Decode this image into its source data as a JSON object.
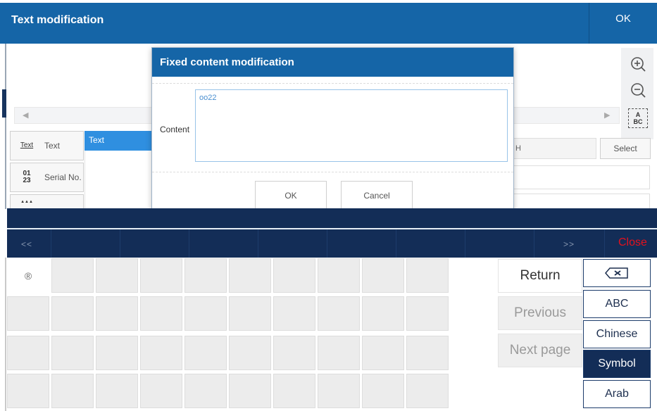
{
  "header": {
    "title": "Text modification",
    "ok_label": "OK"
  },
  "toolbar": {
    "icons": [
      "zoom-in-icon",
      "zoom-out-icon",
      "text-frame-icon"
    ],
    "text_frame_glyph": "A\nBC"
  },
  "objects": [
    {
      "icon_text": "Text",
      "label": "Text"
    },
    {
      "icon_text": "01\n23",
      "label": "Serial No."
    },
    {
      "icon_text": "▲▲▲",
      "label": ""
    }
  ],
  "list": {
    "selected_item": "Text"
  },
  "field": {
    "header_text": "H",
    "select_label": "Select"
  },
  "dialog": {
    "title": "Fixed content modification",
    "content_label": "Content",
    "content_value": "oo22",
    "ok_label": "OK",
    "cancel_label": "Cancel"
  },
  "keyboard": {
    "prev_label": "<<",
    "next_label": ">>",
    "close_label": "Close",
    "first_key": "®",
    "actions": {
      "return": "Return",
      "previous": "Previous",
      "next_page": "Next page"
    },
    "modes": [
      "ABC",
      "Chinese",
      "Symbol",
      "Arab"
    ],
    "selected_mode": "Symbol",
    "colors": {
      "bar": "#132d57",
      "close": "#e4111d",
      "header": "#1565a7"
    }
  }
}
